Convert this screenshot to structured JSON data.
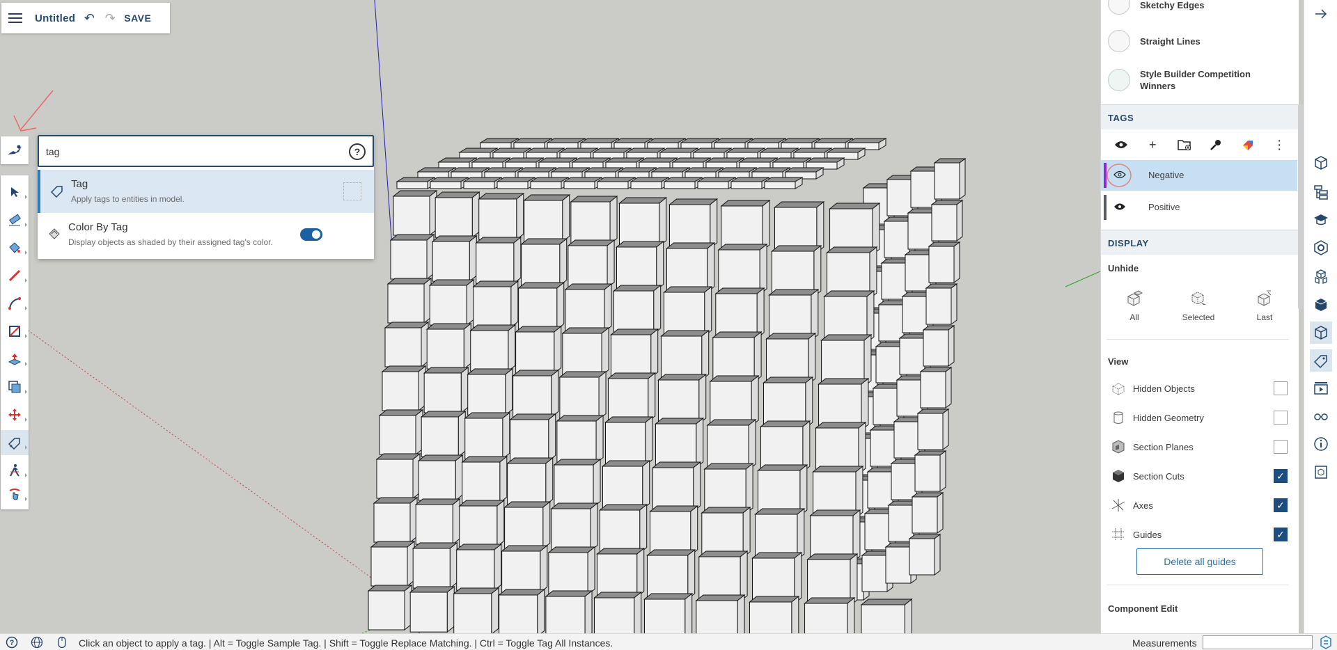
{
  "app": {
    "file_title": "Untitled",
    "save_label": "SAVE"
  },
  "search": {
    "query": "tag",
    "help_label": "?",
    "results": [
      {
        "title": "Tag",
        "description": "Apply tags to entities in model.",
        "selected": true
      },
      {
        "title": "Color By Tag",
        "description": "Display objects as shaded by their assigned tag's color.",
        "toggle_on": true
      }
    ]
  },
  "toolbar": {
    "tools": [
      "select-tool",
      "eraser-tool",
      "paint-bucket-tool",
      "pencil-tool",
      "arc-tool",
      "rectangle-tool",
      "push-pull-tool",
      "offset-tool",
      "move-tool",
      "tag-tool",
      "walk-tool",
      "orbit-tool"
    ],
    "active_tool": "tag-tool"
  },
  "panel": {
    "styles": {
      "items": [
        "Sketchy Edges",
        "Straight Lines",
        "Style Builder Competition Winners"
      ]
    },
    "tags": {
      "header": "TAGS",
      "rows": [
        {
          "name": "Negative",
          "color": "#8a2bd8",
          "selected": true
        },
        {
          "name": "Positive",
          "color": "#555a66",
          "selected": false
        }
      ]
    },
    "display": {
      "header": "DISPLAY",
      "unhide_title": "Unhide",
      "unhide_buttons": [
        "All",
        "Selected",
        "Last"
      ],
      "view_title": "View",
      "view_items": [
        {
          "label": "Hidden Objects",
          "checked": false
        },
        {
          "label": "Hidden Geometry",
          "checked": false
        },
        {
          "label": "Section Planes",
          "checked": false
        },
        {
          "label": "Section Cuts",
          "checked": true
        },
        {
          "label": "Axes",
          "checked": true
        },
        {
          "label": "Guides",
          "checked": true
        }
      ],
      "delete_guides_label": "Delete all guides",
      "component_edit_title": "Component Edit"
    }
  },
  "status": {
    "message": "Click an object to apply a tag. | Alt = Toggle Sample Tag. | Shift = Toggle Replace Matching. | Ctrl = Toggle Tag All Instances.",
    "measurements_label": "Measurements",
    "measurements_value": ""
  },
  "colors": {
    "accent": "#244a6e",
    "selection": "#c7dff2",
    "checkbox_on": "#1d4d80"
  }
}
